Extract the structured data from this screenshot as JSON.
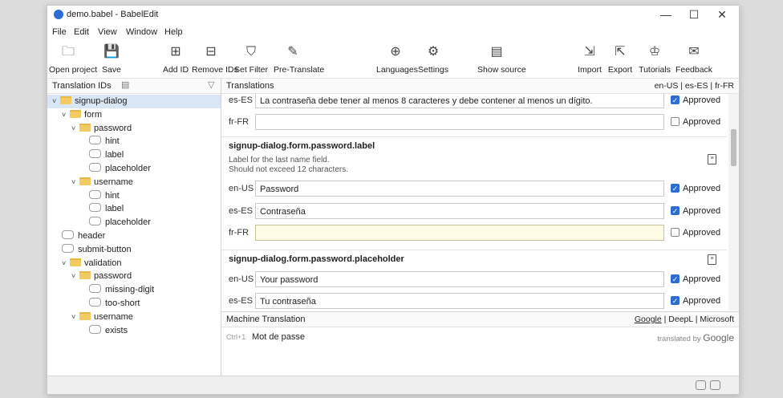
{
  "window": {
    "title": "demo.babel - BabelEdit"
  },
  "controls": {
    "minimize": "—",
    "maximize": "☐",
    "close": "✕"
  },
  "menu": [
    "File",
    "Edit",
    "View",
    "Window",
    "Help"
  ],
  "toolbar": [
    {
      "label": "Open project",
      "icon": "folder-open-icon",
      "glyph": "🗀"
    },
    {
      "label": "Save",
      "icon": "save-icon",
      "glyph": "💾"
    },
    {
      "label": "Add ID",
      "icon": "add-id-icon",
      "glyph": "⊞"
    },
    {
      "label": "Remove IDs",
      "icon": "remove-id-icon",
      "glyph": "⊟"
    },
    {
      "label": "Set Filter",
      "icon": "filter-icon",
      "glyph": "⛉"
    },
    {
      "label": "Pre-Translate",
      "icon": "magic-wand-icon",
      "glyph": "✎"
    },
    {
      "label": "Languages",
      "icon": "globe-icon",
      "glyph": "⊕"
    },
    {
      "label": "Settings",
      "icon": "gear-icon",
      "glyph": "⚙"
    },
    {
      "label": "Show source",
      "icon": "source-icon",
      "glyph": "▤"
    },
    {
      "label": "Import",
      "icon": "import-icon",
      "glyph": "⇲"
    },
    {
      "label": "Export",
      "icon": "export-icon",
      "glyph": "⇱"
    },
    {
      "label": "Tutorials",
      "icon": "graduation-cap-icon",
      "glyph": "♔"
    },
    {
      "label": "Feedback",
      "icon": "feedback-icon",
      "glyph": "✉"
    }
  ],
  "tree": {
    "header": "Translation IDs",
    "items": [
      {
        "label": "signup-dialog",
        "type": "folder",
        "chev": "˅"
      },
      {
        "label": "form",
        "type": "folder",
        "chev": "˅"
      },
      {
        "label": "password",
        "type": "folder",
        "chev": "˅"
      },
      {
        "label": "hint",
        "type": "leaf",
        "chev": ""
      },
      {
        "label": "label",
        "type": "leaf",
        "chev": ""
      },
      {
        "label": "placeholder",
        "type": "leaf",
        "chev": ""
      },
      {
        "label": "username",
        "type": "folder",
        "chev": "˅"
      },
      {
        "label": "hint",
        "type": "leaf",
        "chev": ""
      },
      {
        "label": "label",
        "type": "leaf",
        "chev": ""
      },
      {
        "label": "placeholder",
        "type": "leaf",
        "chev": ""
      },
      {
        "label": "header",
        "type": "leaf",
        "chev": ""
      },
      {
        "label": "submit-button",
        "type": "leaf",
        "chev": ""
      },
      {
        "label": "validation",
        "type": "folder",
        "chev": "˅"
      },
      {
        "label": "password",
        "type": "folder",
        "chev": "˅"
      },
      {
        "label": "missing-digit",
        "type": "leaf",
        "chev": ""
      },
      {
        "label": "too-short",
        "type": "leaf",
        "chev": ""
      },
      {
        "label": "username",
        "type": "folder",
        "chev": "˅"
      },
      {
        "label": "exists",
        "type": "leaf",
        "chev": ""
      }
    ]
  },
  "translations": {
    "header": "Translations",
    "languages": [
      "en-US",
      "es-ES",
      "fr-FR"
    ],
    "approved_label": "Approved",
    "top_rows": [
      {
        "lang": "es-ES",
        "value": "La contraseña debe tener al menos 8 caracteres y debe contener al menos un dígito.",
        "approved": true
      },
      {
        "lang": "fr-FR",
        "value": "",
        "approved": false
      }
    ],
    "blocks": [
      {
        "key": "signup-dialog.form.password.label",
        "desc1": "Label for the last name field.",
        "desc2": "Should not exceed 12 characters.",
        "rows": [
          {
            "lang": "en-US",
            "value": "Password",
            "approved": true
          },
          {
            "lang": "es-ES",
            "value": "Contraseña",
            "approved": true
          },
          {
            "lang": "fr-FR",
            "value": "",
            "approved": false
          }
        ]
      },
      {
        "key": "signup-dialog.form.password.placeholder",
        "rows": [
          {
            "lang": "en-US",
            "value": "Your password",
            "approved": true
          },
          {
            "lang": "es-ES",
            "value": "Tu contraseña",
            "approved": true
          }
        ]
      }
    ]
  },
  "machine_translation": {
    "header": "Machine Translation",
    "providers": [
      "Google",
      "DeepL",
      "Microsoft"
    ],
    "shortcut": "Ctrl+1",
    "suggestion": "Mot de passe",
    "credit_prefix": "translated by",
    "credit_brand": "Google"
  }
}
